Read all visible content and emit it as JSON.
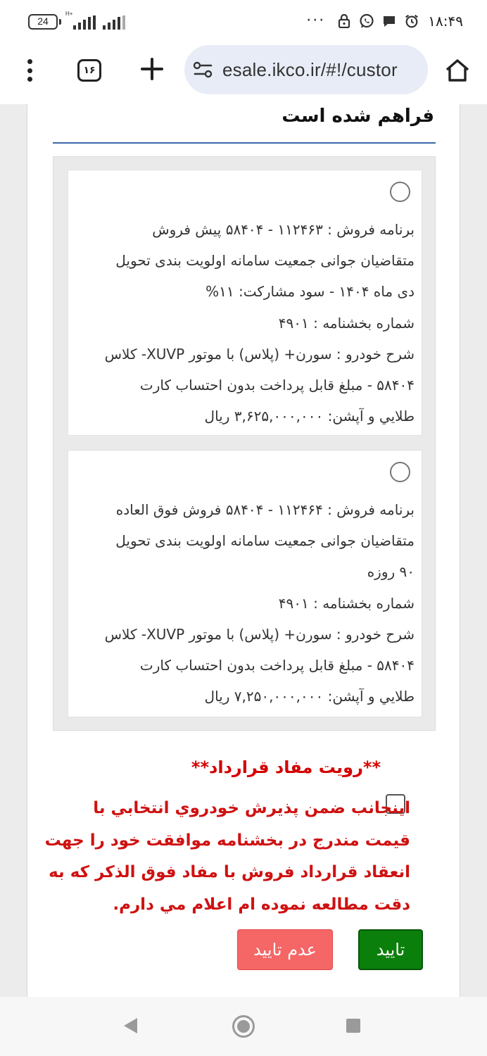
{
  "status_bar": {
    "battery": "24",
    "network_label": "H+",
    "time": "۱۸:۴۹",
    "more_indicator": "···",
    "icons": [
      "lock-icon",
      "whatsapp-icon",
      "chat-bubble-icon",
      "alarm-icon"
    ]
  },
  "browser": {
    "tab_count": "۱۶",
    "url": "esale.ikco.ir/#!/custor",
    "icons": [
      "menu-dots-icon",
      "tabs-icon",
      "new-tab-icon",
      "site-settings-icon",
      "home-icon"
    ]
  },
  "page": {
    "heading_tail": "فراهم شده است",
    "options": [
      {
        "lines": [
          "برنامه فروش : ۱۱۲۴۶۳ - ۵۸۴۰۴ پیش فروش",
          "متقاضیان جوانی جمعیت سامانه اولویت بندی تحویل",
          "دی ماه ۱۴۰۴ - سود مشارکت: ۱۱%",
          "شماره بخشنامه : ۴۹۰۱",
          "شرح خودرو : سورن+ (پلاس) با موتور XUVP- کلاس",
          "۵۸۴۰۴ - مبلغ قابل پرداخت بدون احتساب کارت",
          "طلايي و آپشن: ۳,۶۲۵,۰۰۰,۰۰۰ ريال"
        ]
      },
      {
        "lines": [
          "برنامه فروش : ۱۱۲۴۶۴ - ۵۸۴۰۴ فروش فوق العاده",
          "متقاضیان جوانی جمعیت سامانه اولویت بندی تحویل",
          "۹۰ روزه",
          "شماره بخشنامه : ۴۹۰۱",
          "شرح خودرو : سورن+ (پلاس) با موتور XUVP- کلاس",
          "۵۸۴۰۴ - مبلغ قابل پرداخت بدون احتساب کارت",
          "طلايي و آپشن: ۷,۲۵۰,۰۰۰,۰۰۰ ريال"
        ]
      }
    ],
    "consent_title": "**رويت مفاد قرارداد**",
    "consent_lines": [
      "اينجانب ضمن پذيرش خودروي انتخابي با",
      "قيمت مندرج در بخشنامه موافقت خود را جهت",
      "انعقاد قرارداد فروش با مفاد فوق الذکر که به",
      "دقت مطالعه نموده ام اعلام مي دارم."
    ],
    "confirm_label": "تایید",
    "reject_label": "عدم تایید",
    "colors": {
      "consent_red": "#cf1111",
      "confirm_green": "#0b7f0b",
      "reject_red": "#f56666",
      "rule_blue": "#3a67a8"
    }
  },
  "nav_bar": {
    "icons": [
      "back-icon",
      "home-circle-icon",
      "recents-icon"
    ]
  }
}
